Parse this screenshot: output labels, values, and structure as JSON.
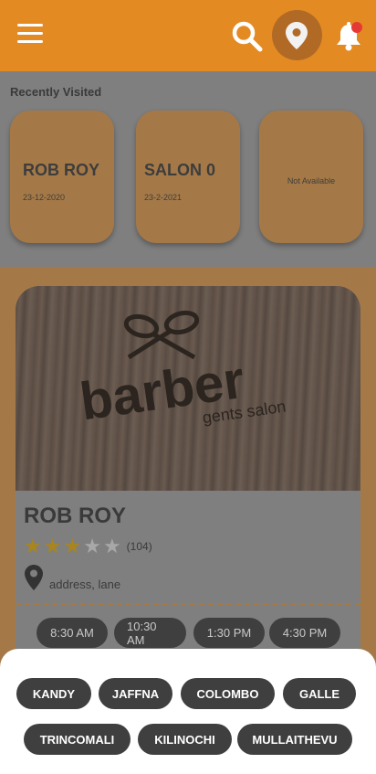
{
  "header": {
    "menu_icon": "hamburger-menu-icon",
    "search_icon": "search-icon",
    "location_icon": "location-pin-icon",
    "notification_icon": "bell-icon",
    "colors": {
      "header_bg": "#e48a22",
      "notification_dot": "#e53935"
    }
  },
  "recently_visited": {
    "title": "Recently Visited",
    "cards": [
      {
        "name": "ROB ROY",
        "date": "23-12-2020"
      },
      {
        "name": "SALON 0",
        "date": "23-2-2021"
      },
      {
        "name": "",
        "date": "",
        "placeholder": "Not Available"
      }
    ]
  },
  "salon": {
    "image": {
      "logo_text": "barber",
      "logo_subtext": "gents salon"
    },
    "name": "ROB ROY",
    "rating": 3,
    "rating_max": 5,
    "review_count": "(104)",
    "address": "address, lane",
    "time_slots": [
      "8:30 AM",
      "10:30 AM",
      "1:30 PM",
      "4:30 PM"
    ]
  },
  "location_filter": {
    "row1": [
      "KANDY",
      "JAFFNA",
      "COLOMBO",
      "GALLE"
    ],
    "row2": [
      "TRINCOMALI",
      "KILINOCHI",
      "MULLAITHEVU"
    ]
  }
}
